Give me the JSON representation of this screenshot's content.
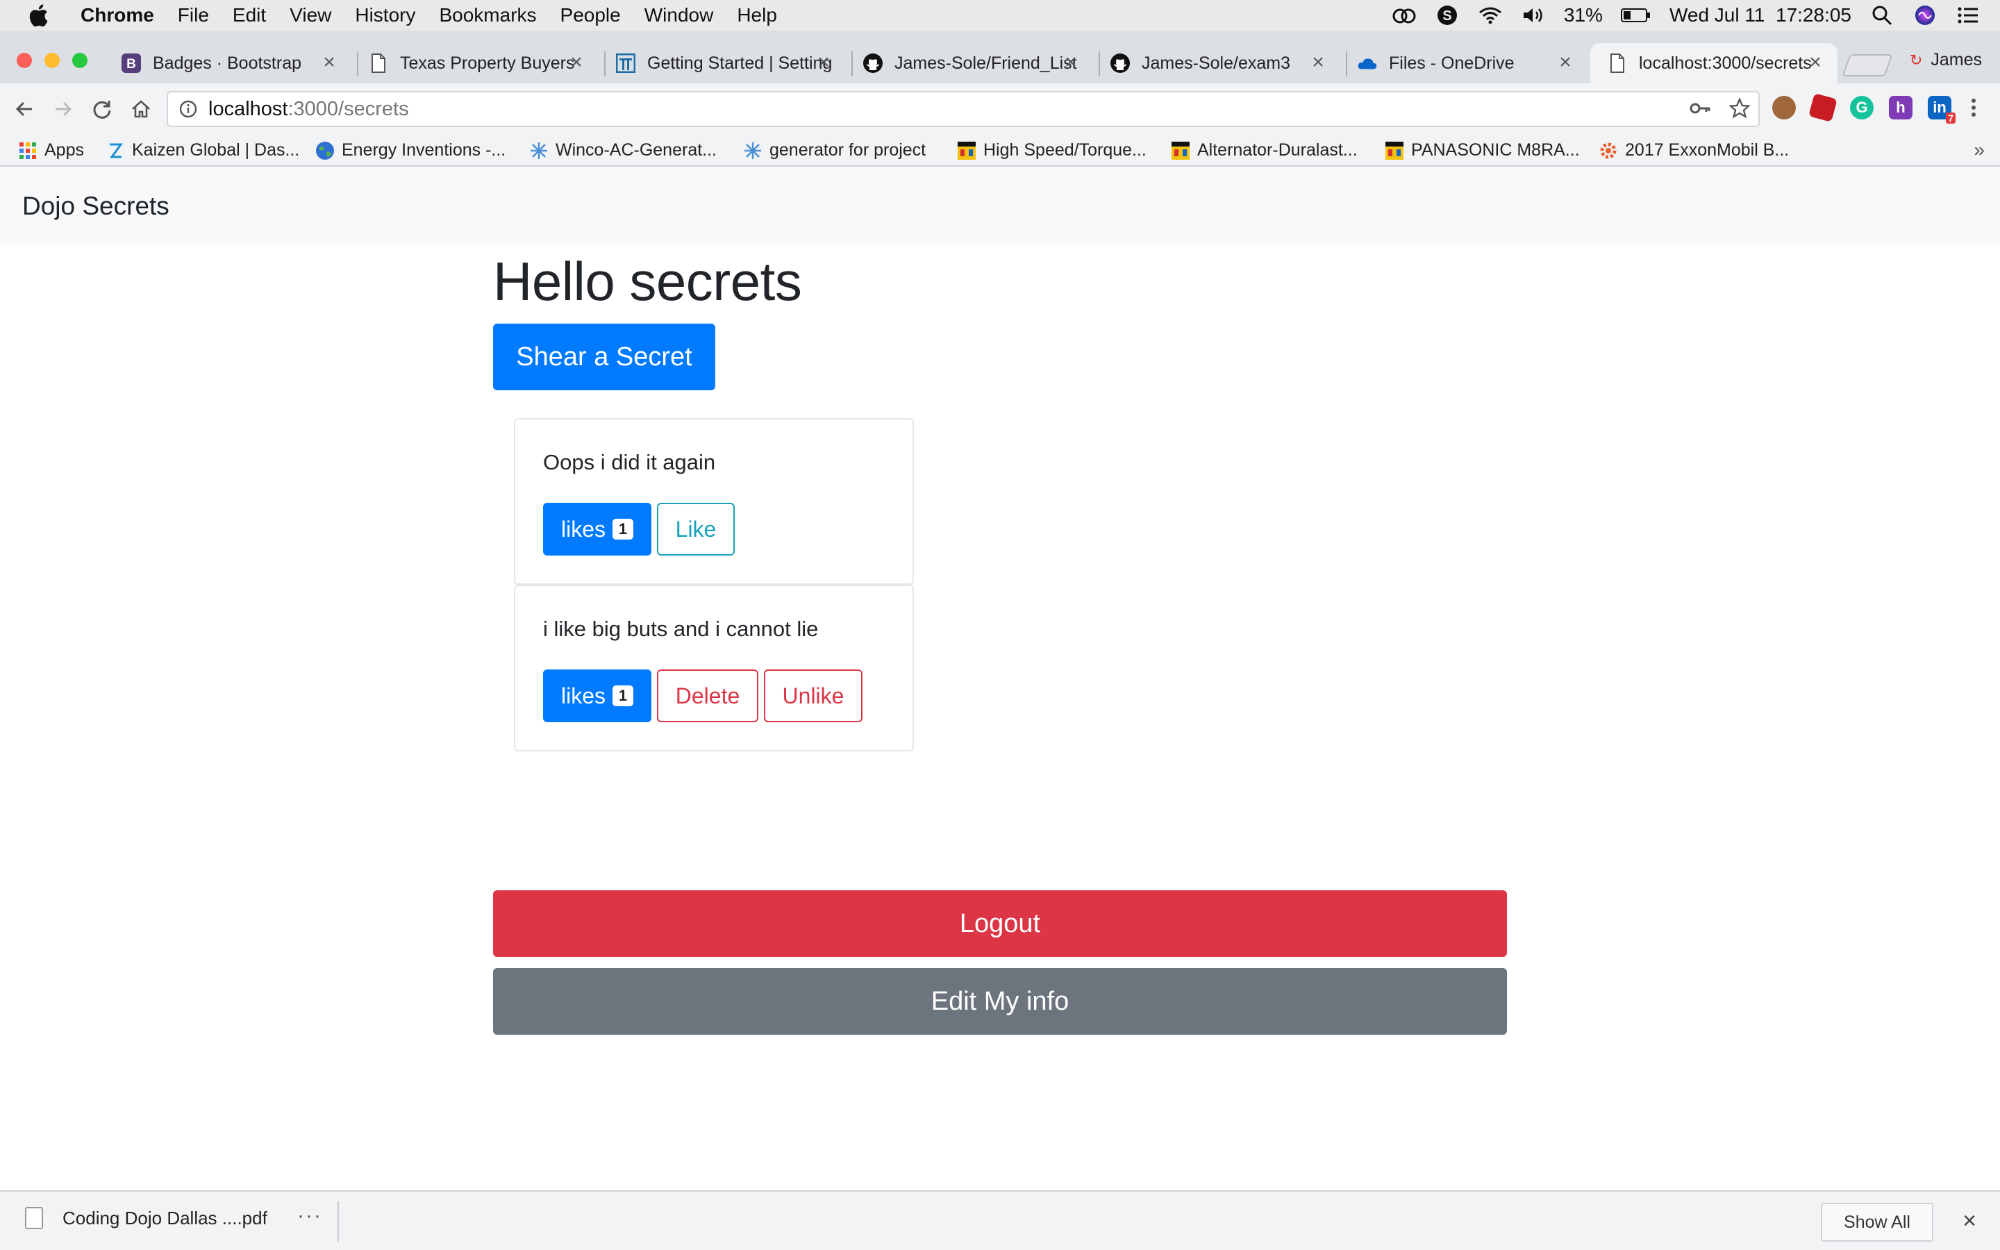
{
  "menubar": {
    "app_name": "Chrome",
    "items": [
      "File",
      "Edit",
      "View",
      "History",
      "Bookmarks",
      "People",
      "Window",
      "Help"
    ],
    "battery": "31%",
    "clock": "Wed Jul 11  17:28:05"
  },
  "tabs": [
    {
      "title": "Badges · Bootstrap",
      "icon": "bootstrap-icon"
    },
    {
      "title": "Texas Property Buyers",
      "icon": "page-icon"
    },
    {
      "title": "Getting Started | Settings",
      "icon": "gate-icon"
    },
    {
      "title": "James-Sole/Friend_List",
      "icon": "github-icon"
    },
    {
      "title": "James-Sole/exam3",
      "icon": "github-icon"
    },
    {
      "title": "Files - OneDrive",
      "icon": "onedrive-icon"
    },
    {
      "title": "localhost:3000/secrets",
      "icon": "page-icon",
      "active": true
    }
  ],
  "profile_name": "James",
  "address": {
    "host": "localhost",
    "path": ":3000/secrets"
  },
  "bookmarks": [
    {
      "label": "Apps",
      "icon": "apps-grid-icon"
    },
    {
      "label": "Kaizen Global | Das...",
      "icon": "kaizen-icon"
    },
    {
      "label": "Energy Inventions -...",
      "icon": "globe-icon"
    },
    {
      "label": "Winco-AC-Generat...",
      "icon": "spark-icon"
    },
    {
      "label": "generator for project",
      "icon": "spark-icon"
    },
    {
      "label": "High Speed/Torque...",
      "icon": "store-icon"
    },
    {
      "label": "Alternator-Duralast...",
      "icon": "store-icon"
    },
    {
      "label": "PANASONIC M8RA...",
      "icon": "store-icon"
    },
    {
      "label": "2017 ExxonMobil B...",
      "icon": "gear-icon"
    }
  ],
  "page": {
    "brand": "Dojo Secrets",
    "heading": "Hello secrets",
    "share_button": "Shear a Secret",
    "secrets": [
      {
        "text": "Oops i did it again",
        "likes_label": "likes",
        "likes_count": "1",
        "actions": [
          "Like"
        ]
      },
      {
        "text": "i like big buts and i cannot lie",
        "likes_label": "likes",
        "likes_count": "1",
        "actions": [
          "Delete",
          "Unlike"
        ]
      }
    ],
    "logout_button": "Logout",
    "edit_button": "Edit My info"
  },
  "downloads": {
    "file_name": "Coding Dojo Dallas ....pdf",
    "more": "···",
    "show_all": "Show All"
  },
  "colors": {
    "primary": "#007bff",
    "danger": "#dc3545",
    "secondary": "#6c757d",
    "info": "#17a2b8"
  }
}
